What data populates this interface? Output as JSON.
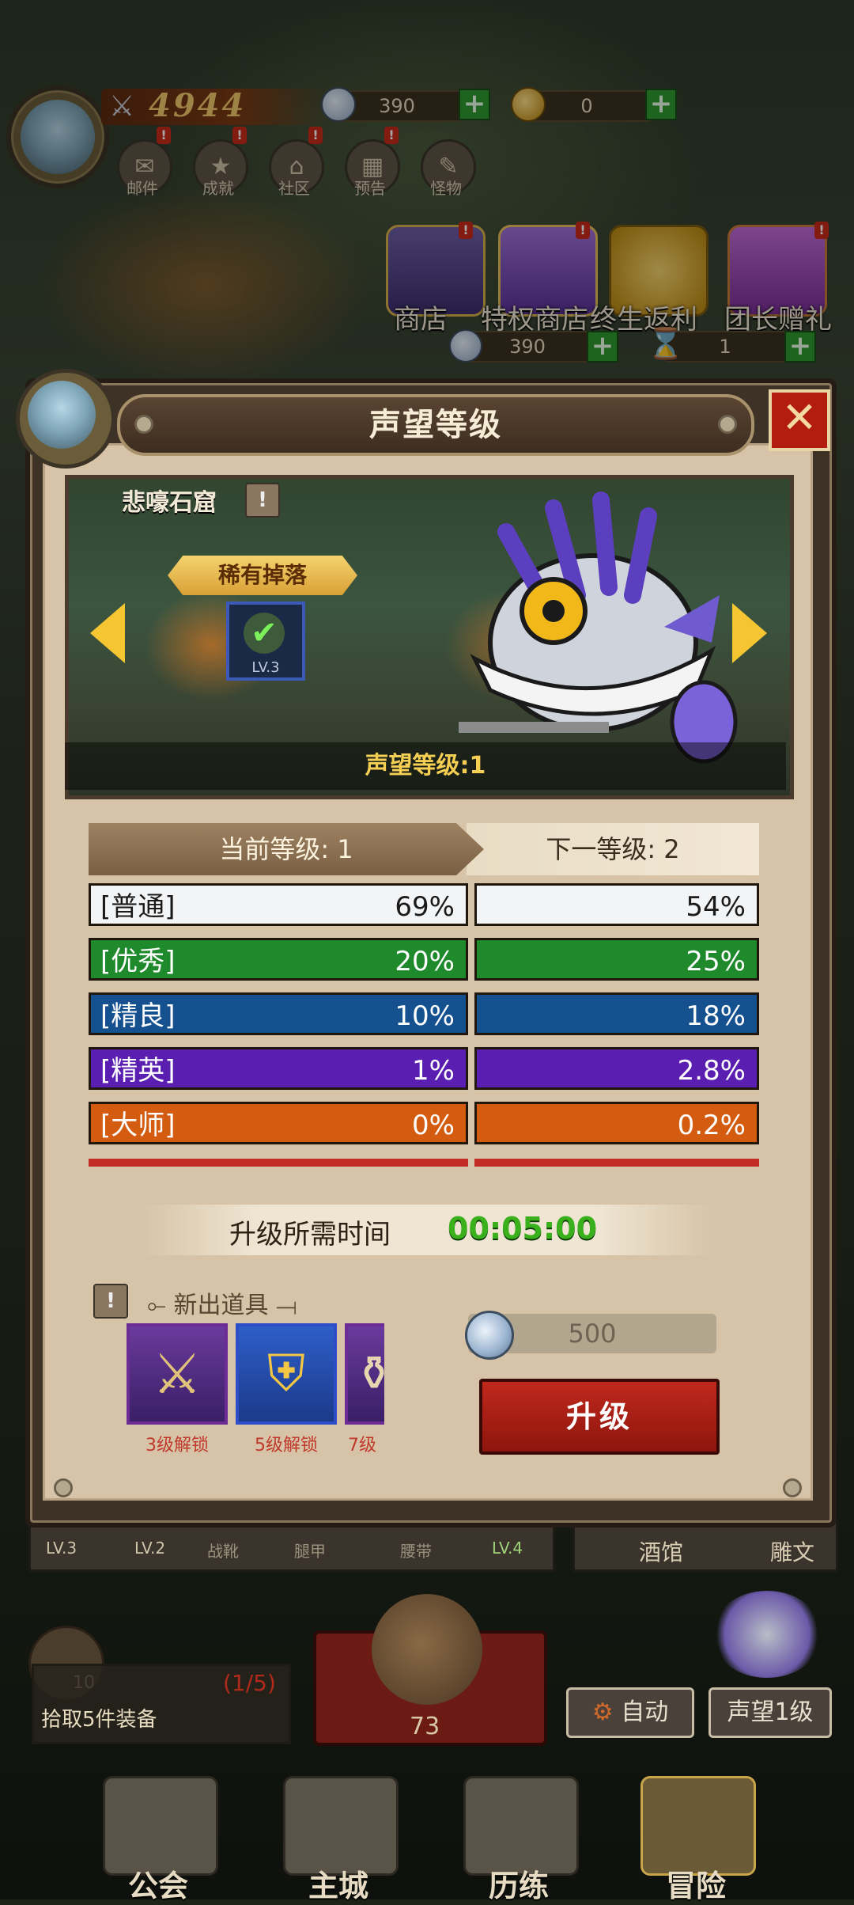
{
  "hud": {
    "power": "4944",
    "gems": "390",
    "gold": "0",
    "nav_icons": [
      {
        "label": "邮件",
        "icon": "mail-icon"
      },
      {
        "label": "成就",
        "icon": "achievement-icon"
      },
      {
        "label": "社区",
        "icon": "community-icon"
      },
      {
        "label": "预告",
        "icon": "calendar-icon"
      },
      {
        "label": "怪物",
        "icon": "monster-book-icon"
      }
    ],
    "shops": [
      "商店",
      "特权商店",
      "终生返利",
      "团长赠礼"
    ],
    "gems2": "390",
    "hourglass": "1"
  },
  "modal": {
    "title": "声望等级",
    "close_symbol": "✕",
    "area_name": "悲嚎石窟",
    "rare_drop": "稀有掉落",
    "item_level": "LV.3",
    "reputation_level": "声望等级:1",
    "current_level_label": "当前等级: 1",
    "next_level_label": "下一等级: 2",
    "rows": [
      {
        "name": "[普通]",
        "current": "69%",
        "next": "54%",
        "bg": "#f3f4f6",
        "fg": "#1a1a1a"
      },
      {
        "name": "[优秀]",
        "current": "20%",
        "next": "25%",
        "bg": "#1e8a2c",
        "fg": "#ffffff"
      },
      {
        "name": "[精良]",
        "current": "10%",
        "next": "18%",
        "bg": "#15508f",
        "fg": "#ffffff"
      },
      {
        "name": "[精英]",
        "current": "1%",
        "next": "2.8%",
        "bg": "#5a1fb0",
        "fg": "#ffffff"
      },
      {
        "name": "[大师]",
        "current": "0%",
        "next": "0.2%",
        "bg": "#d45c10",
        "fg": "#ffffff"
      }
    ],
    "time_label": "升级所需时间",
    "time_value": "00:05:00",
    "new_items_label": "新出道具",
    "new_items": [
      {
        "unlock": "3级解锁",
        "icon": "crossed-swords-icon"
      },
      {
        "unlock": "5级解锁",
        "icon": "chest-armor-icon"
      },
      {
        "unlock": "7级",
        "icon": "potion-icon"
      }
    ],
    "cost": "500",
    "upgrade_label": "升级"
  },
  "bottom": {
    "equip_levels": [
      "LV.3",
      "LV.2",
      "战靴",
      "腿甲",
      "腰带",
      "LV.4"
    ],
    "tavern": "酒馆",
    "carving": "雕文",
    "loot_count": "10",
    "loot_progress": "(1/5)",
    "loot_task": "拾取5件装备",
    "bag_count": "73",
    "auto_label": "自动",
    "reputation_button": "声望1级",
    "nav": [
      "公会",
      "主城",
      "历练",
      "冒险"
    ]
  },
  "colors": {
    "accent_red": "#b21d10",
    "time_green": "#39b01c",
    "gold_text": "#f5cf53"
  }
}
